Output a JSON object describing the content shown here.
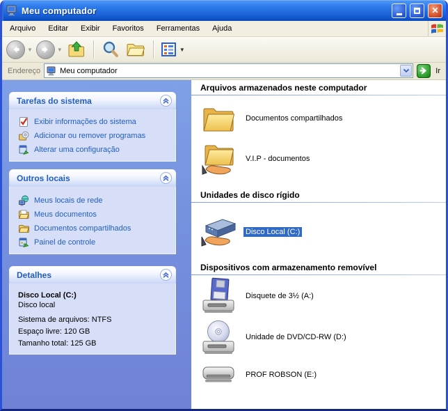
{
  "window": {
    "title": "Meu computador"
  },
  "menu": {
    "items": [
      "Arquivo",
      "Editar",
      "Exibir",
      "Favoritos",
      "Ferramentas",
      "Ajuda"
    ]
  },
  "toolbar": {
    "buttons": [
      "back",
      "forward",
      "up",
      "search",
      "folders",
      "views"
    ]
  },
  "address_bar": {
    "label": "Endereço",
    "value": "Meu computador",
    "go_label": "Ir"
  },
  "sidebar": {
    "system_tasks": {
      "title": "Tarefas do sistema",
      "items": [
        {
          "label": "Exibir informações do sistema",
          "icon": "system-properties-icon"
        },
        {
          "label": "Adicionar ou remover programas",
          "icon": "add-remove-programs-icon"
        },
        {
          "label": "Alterar uma configuração",
          "icon": "change-setting-icon"
        }
      ]
    },
    "other_places": {
      "title": "Outros locais",
      "items": [
        {
          "label": "Meus locais de rede",
          "icon": "network-places-icon"
        },
        {
          "label": "Meus documentos",
          "icon": "my-documents-icon"
        },
        {
          "label": "Documentos compartilhados",
          "icon": "shared-documents-icon"
        },
        {
          "label": "Painel de controle",
          "icon": "control-panel-icon"
        }
      ]
    },
    "details": {
      "title": "Detalhes",
      "item_name": "Disco Local (C:)",
      "item_type": "Disco local",
      "file_system": "Sistema de arquivos: NTFS",
      "free_space": "Espaço livre: 120 GB",
      "total_size": "Tamanho total: 125 GB"
    }
  },
  "main": {
    "groups": [
      {
        "header": "Arquivos armazenados neste computador",
        "items": [
          {
            "label": "Documentos compartilhados",
            "icon": "folder-icon",
            "selected": false
          },
          {
            "label": "V.I.P - documentos",
            "icon": "shared-folder-icon",
            "selected": false
          }
        ]
      },
      {
        "header": "Unidades de disco rígido",
        "items": [
          {
            "label": "Disco Local (C:)",
            "icon": "hard-disk-shared-icon",
            "selected": true
          }
        ]
      },
      {
        "header": "Dispositivos com armazenamento removível",
        "items": [
          {
            "label": "Disquete de 3½ (A:)",
            "icon": "floppy-drive-icon",
            "selected": false
          },
          {
            "label": "Unidade de DVD/CD-RW (D:)",
            "icon": "cd-drive-icon",
            "selected": false
          },
          {
            "label": "PROF ROBSON (E:)",
            "icon": "removable-drive-icon",
            "selected": false
          }
        ]
      }
    ]
  },
  "colors": {
    "titlebar_blue": "#1b63d9",
    "window_border": "#2a52d8",
    "sidebar_top": "#7fa0e6",
    "sidebar_bottom": "#6f82d6",
    "panel_body": "#d6dff7",
    "link_blue": "#215dc6",
    "selection_blue": "#316ac5",
    "go_green": "#2a9c2a"
  }
}
